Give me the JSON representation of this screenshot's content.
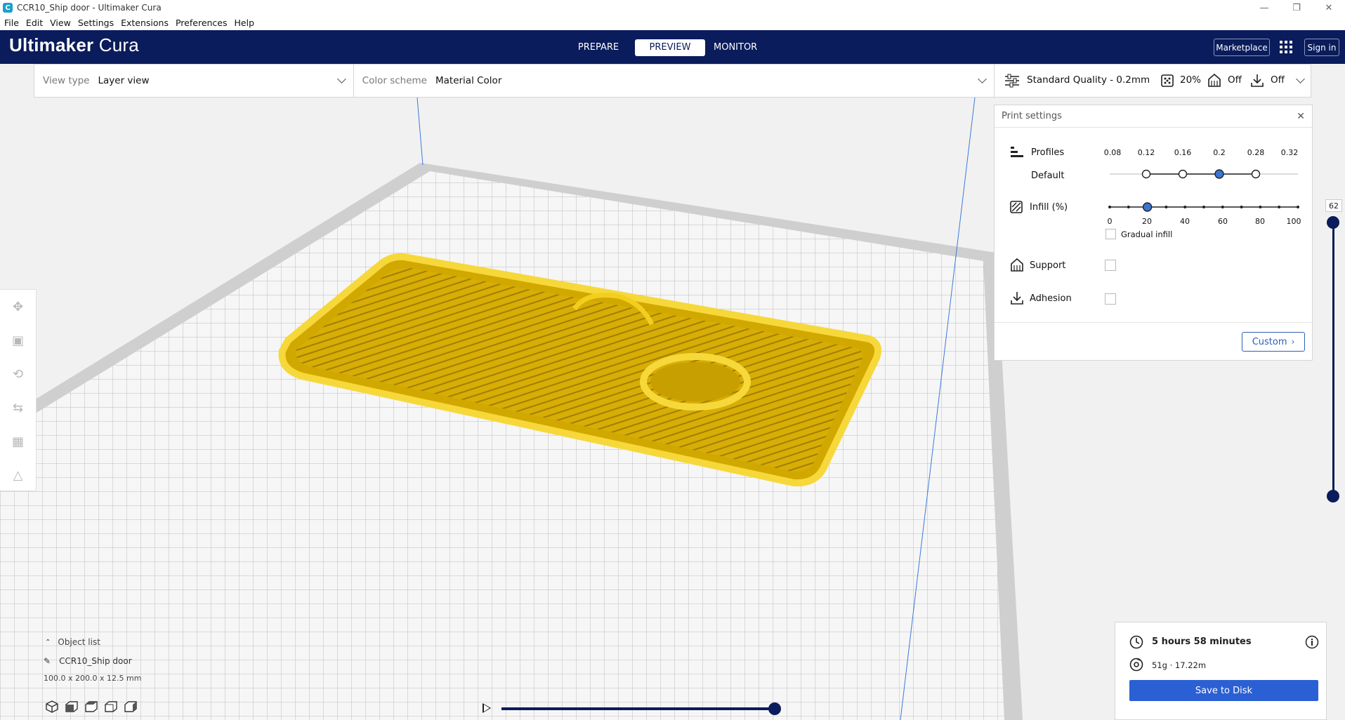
{
  "window": {
    "title": "CCR10_Ship door - Ultimaker Cura",
    "app_icon": "C",
    "controls": [
      "minimize-icon",
      "restore-icon",
      "close-icon"
    ]
  },
  "menu": [
    "File",
    "Edit",
    "View",
    "Settings",
    "Extensions",
    "Preferences",
    "Help"
  ],
  "header": {
    "logo_bold": "Ultimaker",
    "logo_light": " Cura",
    "stages": [
      "PREPARE",
      "PREVIEW",
      "MONITOR"
    ],
    "active_stage": "PREVIEW",
    "marketplace": "Marketplace",
    "signin": "Sign in",
    "colors": {
      "header_bg": "#0a1c5b",
      "accent": "#2b5fd4",
      "model": "#f2cf1f"
    }
  },
  "viewbar": {
    "view_type_label": "View type",
    "view_type_value": "Layer view",
    "color_scheme_label": "Color scheme",
    "color_scheme_value": "Material Color"
  },
  "settings_summary": {
    "quality": "Standard Quality - 0.2mm",
    "infill": "20%",
    "support": "Off",
    "adhesion": "Off"
  },
  "print_settings": {
    "title": "Print settings",
    "profiles_label": "Profiles",
    "profile_name": "Default",
    "layer_heights": [
      "0.08",
      "0.12",
      "0.16",
      "0.2",
      "0.28",
      "0.32"
    ],
    "selected_layer_height": "0.2",
    "infill_label": "Infill (%)",
    "infill_ticks": [
      "0",
      "20",
      "40",
      "60",
      "80",
      "100"
    ],
    "infill_value": 20,
    "gradual_infill_label": "Gradual infill",
    "gradual_infill_checked": false,
    "support_label": "Support",
    "support_checked": false,
    "adhesion_label": "Adhesion",
    "adhesion_checked": false,
    "custom_button": "Custom"
  },
  "layer_slider": {
    "value": "62"
  },
  "object": {
    "list_label": "Object list",
    "name": "CCR10_Ship door",
    "dimensions": "100.0 x 200.0 x 12.5 mm"
  },
  "output": {
    "time": "5 hours 58 minutes",
    "material": "51g · 17.22m",
    "save_button": "Save to Disk"
  }
}
